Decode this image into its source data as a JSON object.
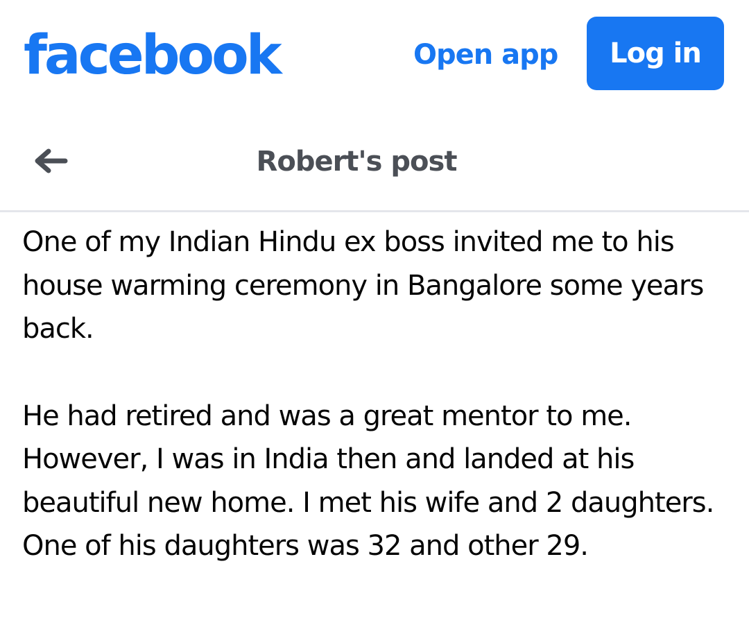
{
  "header": {
    "logo_text": "facebook",
    "open_app_label": "Open app",
    "login_label": "Log in"
  },
  "subheader": {
    "back_icon": "arrow-left-icon",
    "title": "Robert's post"
  },
  "post": {
    "paragraphs": [
      "One of my Indian Hindu ex boss invited me to his house warming ceremony in Bangalore some years back.",
      "He had retired and was a great mentor to me. However, I was in India then and landed at his beautiful new home. I met his wife and 2 daughters. One of his daughters was 32 and other 29."
    ]
  },
  "colors": {
    "brand": "#1877f2",
    "title_gray": "#4b4f56",
    "divider": "#e4e6eb",
    "text": "#050505"
  }
}
